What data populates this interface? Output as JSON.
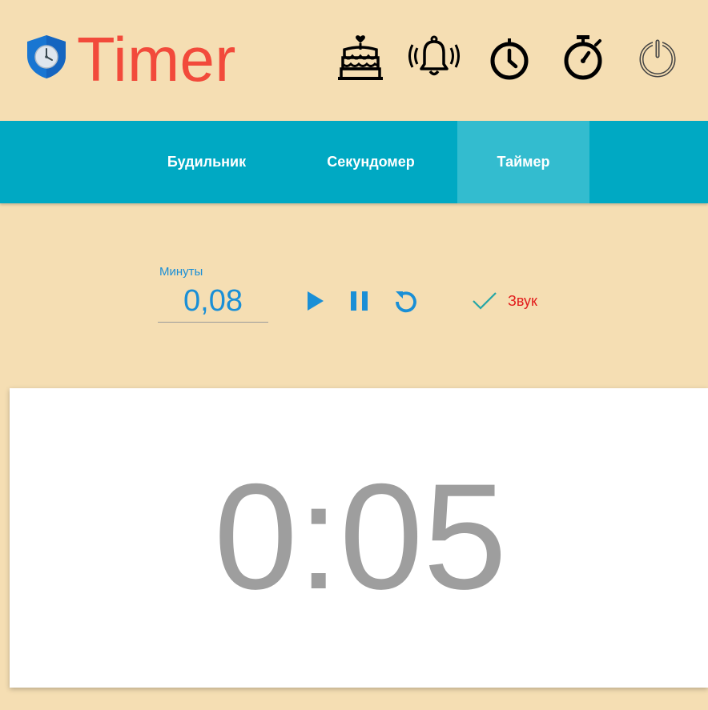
{
  "app": {
    "title": "Timer"
  },
  "header": {
    "icons": [
      "shield-clock-icon",
      "birthday-cake-icon",
      "ringing-bell-icon",
      "clock-icon",
      "stopwatch-icon",
      "power-icon"
    ]
  },
  "nav": {
    "tabs": [
      {
        "label": "Будильник",
        "active": false
      },
      {
        "label": "Секундомер",
        "active": false
      },
      {
        "label": "Таймер",
        "active": true
      }
    ]
  },
  "timer": {
    "minutes_label": "Минуты",
    "minutes_value": "0,08",
    "sound_label": "Звук",
    "sound_enabled": true,
    "controls": [
      "play-icon",
      "pause-icon",
      "reset-icon"
    ],
    "display": "0:05"
  },
  "colors": {
    "background": "#f5deb3",
    "title": "#f24a3b",
    "navbar": "#00a9c3",
    "nav_active": "#33bccf",
    "accent": "#1a8fd6",
    "sound_label": "#e21b1b",
    "display_text": "#9e9e9e"
  }
}
